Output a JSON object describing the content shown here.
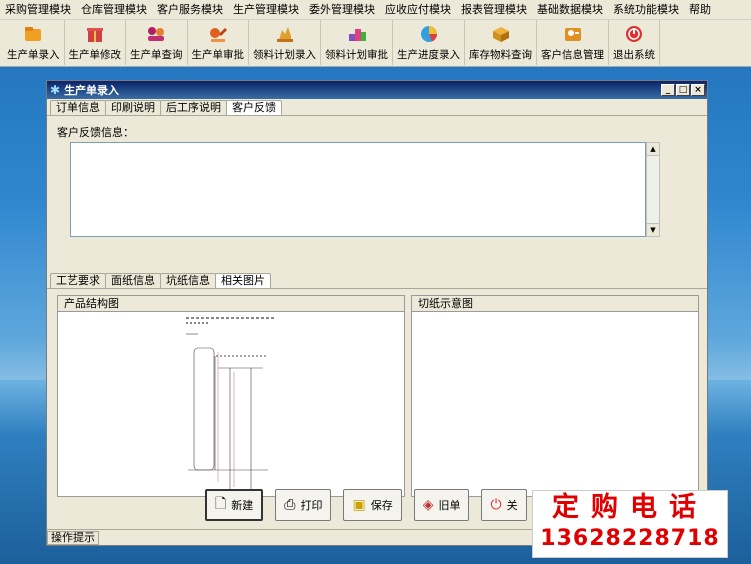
{
  "menubar": {
    "items": [
      "采购管理模块",
      "仓库管理模块",
      "客户服务模块",
      "生产管理模块",
      "委外管理模块",
      "应收应付模块",
      "报表管理模块",
      "基础数据模块",
      "系统功能模块",
      "帮助"
    ]
  },
  "toolbar": {
    "buttons": [
      {
        "label": "生产单录入",
        "icon": "folder-icon",
        "color": "#f0a020"
      },
      {
        "label": "生产单修改",
        "icon": "gift-icon",
        "color": "#d04040"
      },
      {
        "label": "生产单查询",
        "icon": "people-icon",
        "color": "#b02060"
      },
      {
        "label": "生产单审批",
        "icon": "approve-icon",
        "color": "#e06020"
      },
      {
        "label": "领料计划录入",
        "icon": "hand-icon",
        "color": "#e0a030"
      },
      {
        "label": "领料计划审批",
        "icon": "blocks-icon",
        "color": "#8050c0"
      },
      {
        "label": "生产进度录入",
        "icon": "pie-chart-icon",
        "color": "#30a0e0"
      },
      {
        "label": "库存物料查询",
        "icon": "box-icon",
        "color": "#d09020"
      },
      {
        "label": "客户信息管理",
        "icon": "contacts-icon",
        "color": "#e09020"
      },
      {
        "label": "退出系统",
        "icon": "exit-icon",
        "color": "#e03030"
      }
    ]
  },
  "window": {
    "title": "生产单录入",
    "controls": {
      "minimize": "_",
      "restore": "□",
      "close": "×"
    }
  },
  "top_tabs": [
    "订单信息",
    "印刷说明",
    "后工序说明",
    "客户反馈"
  ],
  "feedback": {
    "label": "客户反馈信息："
  },
  "bottom_tabs": [
    "工艺要求",
    "面纸信息",
    "坑纸信息",
    "相关图片"
  ],
  "groups": {
    "structure": "产品结构图",
    "cutting": "切纸示意图"
  },
  "buttons": {
    "new": "新建",
    "print": "打印",
    "save": "保存",
    "old": "旧单",
    "close": "关"
  },
  "status": {
    "hint": "操作提示"
  },
  "ad": {
    "line1": "定购电话",
    "line2": "13628228718"
  },
  "colors": {
    "title_bar": "#0a246a",
    "ad_red": "#e00000"
  }
}
